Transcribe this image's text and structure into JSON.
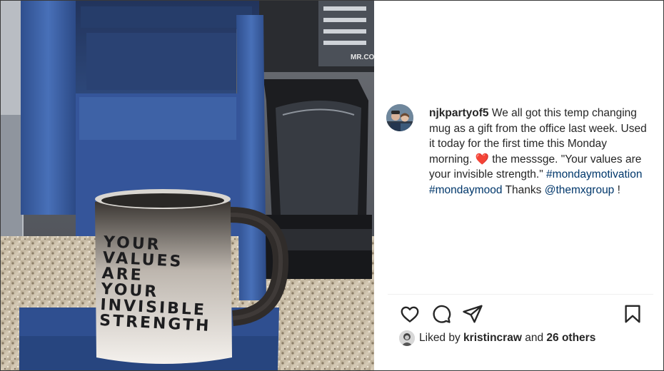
{
  "post": {
    "username": "njkpartyof5",
    "caption_part1": " We all got this temp changing mug as a gift from the office last week. Used it today for the first time this Monday morning. ",
    "heart": "❤️",
    "caption_part2": " the messsge. \"Your values are your invisible strength.\" ",
    "hashtag1": "#mondaymotivation",
    "hashtag2": "#mondaymood",
    "caption_part3": " Thanks ",
    "mention": "@themxgroup",
    "caption_end": " !"
  },
  "photo": {
    "mug_lines": [
      "YOUR",
      "VALUES",
      "ARE",
      "YOUR",
      "INVISIBLE",
      "STRENGTH"
    ],
    "coffee_pot_brand": "MR.COFFEE"
  },
  "likes": {
    "prefix": "Liked by ",
    "user": "kristincraw",
    "middle": " and ",
    "count": "26 others"
  },
  "colors": {
    "link": "#00376b",
    "heart": "#ed2b3c",
    "machine_blue": "#3d62a8"
  },
  "icons": [
    "heart-icon",
    "comment-icon",
    "share-icon",
    "bookmark-icon"
  ]
}
